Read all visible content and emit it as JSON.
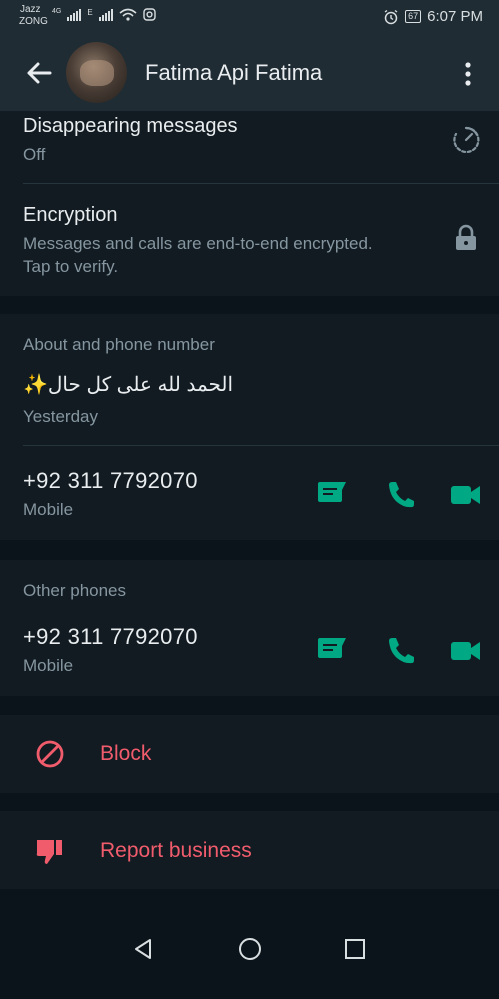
{
  "status_bar": {
    "carrier_1": "Jazz",
    "carrier_2": "ZONG",
    "net_1": "4G",
    "net_2": "E",
    "battery": "67",
    "time": "6:07 PM"
  },
  "header": {
    "title": "Fatima Api Fatima"
  },
  "disappearing": {
    "title": "Disappearing messages",
    "value": "Off"
  },
  "encryption": {
    "title": "Encryption",
    "line1": "Messages and calls are end-to-end encrypted.",
    "line2": "Tap to verify."
  },
  "about": {
    "heading": "About and phone number",
    "status_text": "الحمد لله على كل حال✨",
    "status_time": "Yesterday",
    "phone": "+92 311 7792070",
    "phone_type": "Mobile"
  },
  "other_phones": {
    "heading": "Other phones",
    "phone": "+92 311 7792070",
    "phone_type": "Mobile"
  },
  "actions": {
    "block": "Block",
    "report": "Report business"
  },
  "colors": {
    "accent": "#00a884",
    "danger": "#f15c6d",
    "background": "#0b141a",
    "surface": "#111b21",
    "header": "#1f2c34"
  }
}
